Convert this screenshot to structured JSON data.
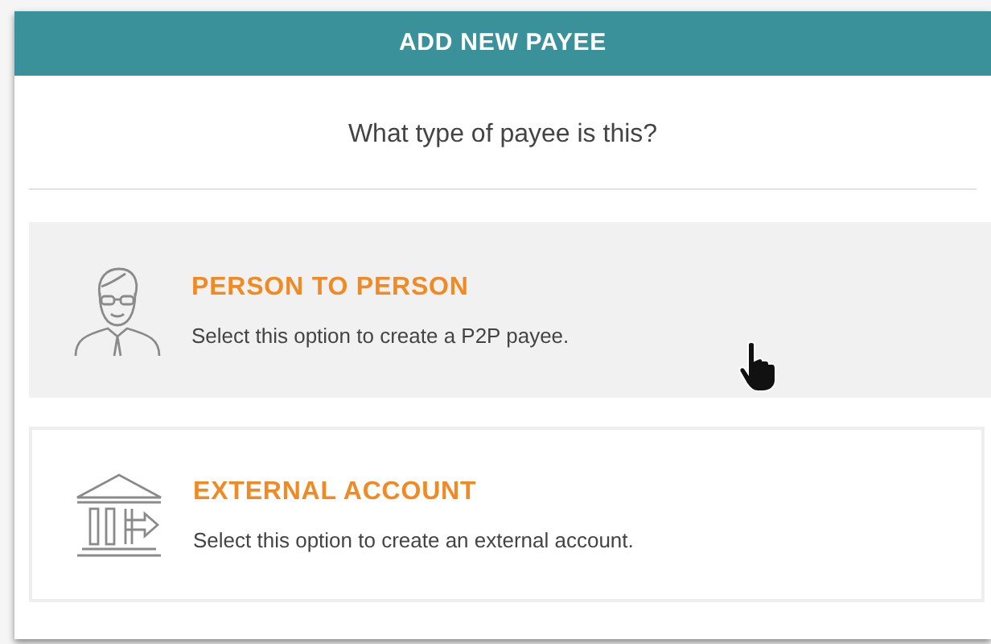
{
  "dialog": {
    "title": "ADD NEW PAYEE",
    "question": "What type of payee is this?"
  },
  "options": [
    {
      "kind": "person",
      "title": "PERSON TO PERSON",
      "description": "Select this option to create a P2P payee.",
      "hovered": true
    },
    {
      "kind": "bank",
      "title": "EXTERNAL ACCOUNT",
      "description": "Select this option to create an external account.",
      "hovered": false
    }
  ]
}
